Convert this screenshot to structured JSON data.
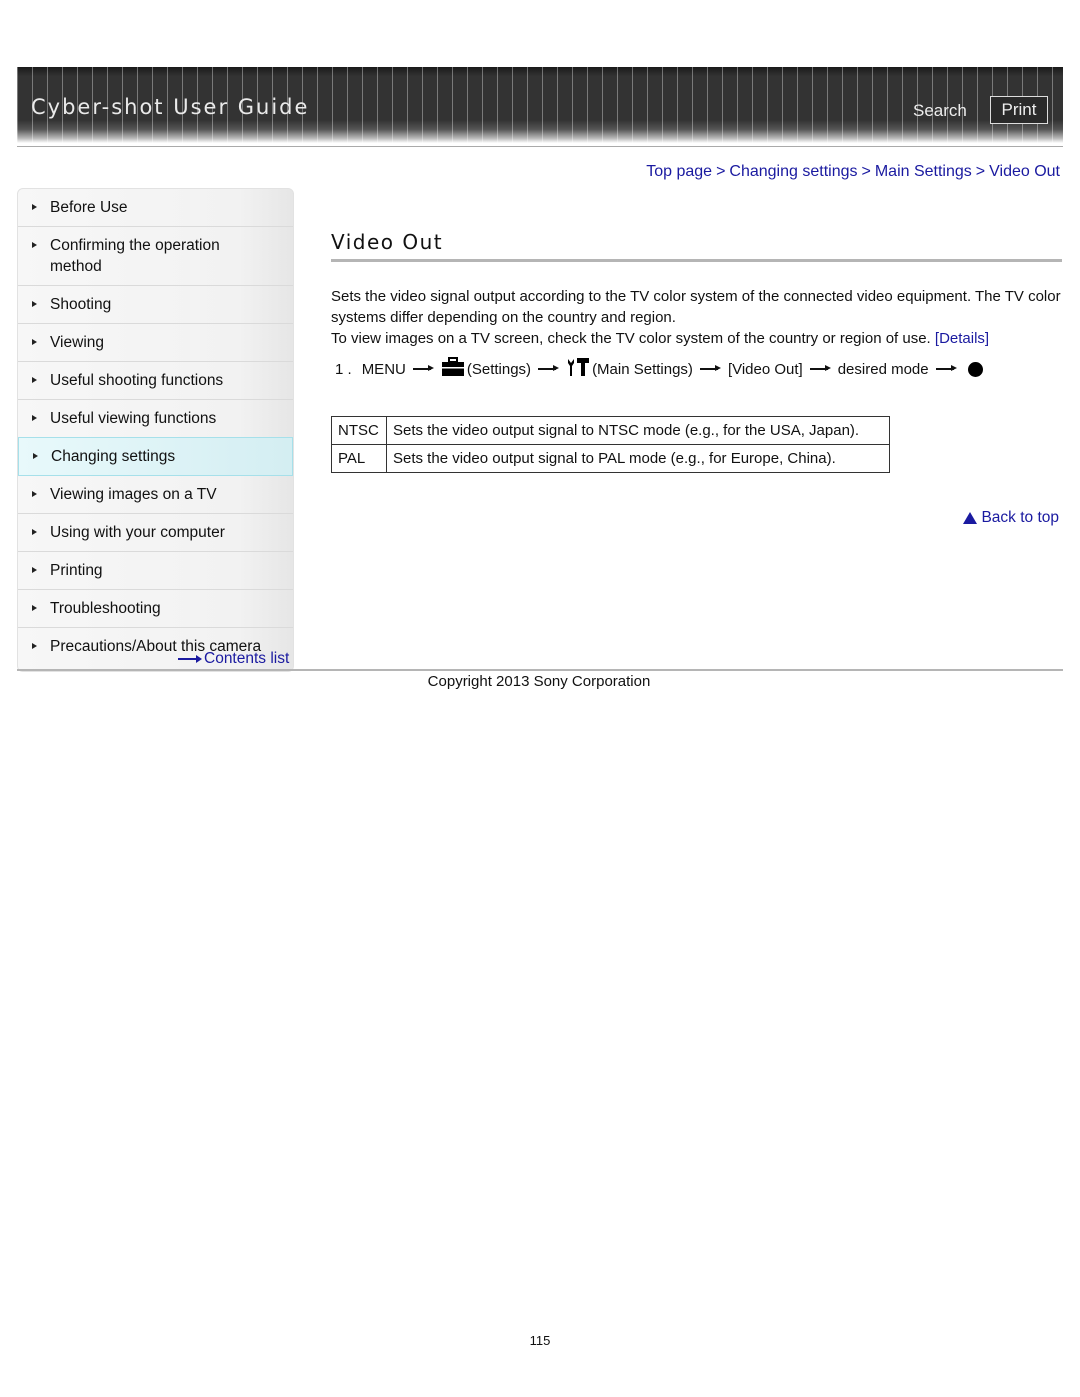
{
  "header": {
    "title": "Cyber-shot User Guide",
    "search_label": "Search",
    "print_label": "Print"
  },
  "breadcrumb": {
    "items": [
      "Top page",
      "Changing settings",
      "Main Settings",
      "Video Out"
    ],
    "separator": ">"
  },
  "sidebar": {
    "items": [
      {
        "label": "Before Use",
        "active": false
      },
      {
        "label": "Confirming the operation method",
        "active": false
      },
      {
        "label": "Shooting",
        "active": false
      },
      {
        "label": "Viewing",
        "active": false
      },
      {
        "label": "Useful shooting functions",
        "active": false
      },
      {
        "label": "Useful viewing functions",
        "active": false
      },
      {
        "label": "Changing settings",
        "active": true
      },
      {
        "label": "Viewing images on a TV",
        "active": false
      },
      {
        "label": "Using with your computer",
        "active": false
      },
      {
        "label": "Printing",
        "active": false
      },
      {
        "label": "Troubleshooting",
        "active": false
      },
      {
        "label": "Precautions/About this camera",
        "active": false
      }
    ],
    "contents_list_label": "Contents list"
  },
  "main": {
    "title": "Video Out",
    "intro_line1": "Sets the video signal output according to the TV color system of the connected video equipment. The TV color systems differ depending on the country and region.",
    "intro_line2": "To view images on a TV screen, check the TV color system of the country or region of use.",
    "details_link": "[Details]",
    "step": {
      "number": "1 .",
      "menu": "MENU",
      "settings": "(Settings)",
      "main_settings": "(Main Settings)",
      "video_out": "[Video Out]",
      "desired_mode": "desired mode"
    },
    "modes": [
      {
        "key": "NTSC",
        "description": "Sets the video output signal to NTSC mode (e.g., for the USA, Japan)."
      },
      {
        "key": "PAL",
        "description": "Sets the video output signal to PAL mode (e.g., for Europe, China)."
      }
    ],
    "back_to_top": "Back to top"
  },
  "footer": {
    "copyright": "Copyright 2013 Sony Corporation",
    "page_number": "115"
  },
  "colors": {
    "link": "#1a1aa0",
    "active_item_bg": "#d4eef2",
    "header_bg": "#333333"
  }
}
